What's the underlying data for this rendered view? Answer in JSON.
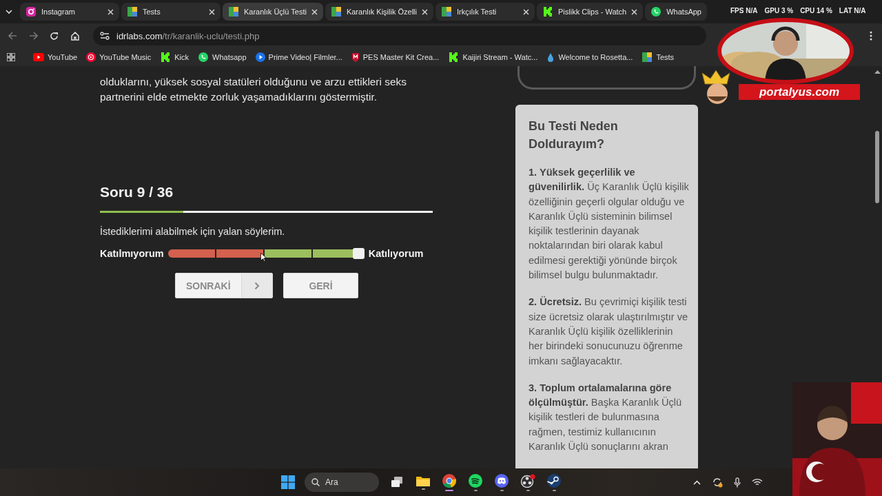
{
  "tabs": [
    {
      "label": "Instagram",
      "kind": "camera",
      "selected": false
    },
    {
      "label": "Tests",
      "kind": "grid",
      "selected": false
    },
    {
      "label": "Karanlık Üçlü Testi",
      "kind": "grid",
      "selected": true
    },
    {
      "label": "Karanlık Kişilik Özelli",
      "kind": "grid",
      "selected": false
    },
    {
      "label": "Irkçılık Testi",
      "kind": "grid",
      "selected": false
    },
    {
      "label": "Pislikk Clips - Watch",
      "kind": "letter",
      "selected": false
    },
    {
      "label": "WhatsApp",
      "kind": "chat",
      "selected": false
    }
  ],
  "toolbar": {
    "url_host": "idrlabs.com",
    "url_path": "/tr/karanlik-uclu/testi.php"
  },
  "bookmarks": [
    {
      "label": "YouTube",
      "kind": "play"
    },
    {
      "label": "YouTube Music",
      "kind": "disc"
    },
    {
      "label": "Kick",
      "kind": "letter"
    },
    {
      "label": "Whatsapp",
      "kind": "chat"
    },
    {
      "label": "Prime Video| Filmler...",
      "kind": "circle"
    },
    {
      "label": "PES Master Kit Crea...",
      "kind": "shield"
    },
    {
      "label": "Kaijiri Stream - Watc...",
      "kind": "letter"
    },
    {
      "label": "Welcome to Rosetta...",
      "kind": "drop"
    },
    {
      "label": "Tests",
      "kind": "grid"
    }
  ],
  "overlay_stats": [
    {
      "label": "FPS",
      "value": "N/A"
    },
    {
      "label": "GPU",
      "value": "3 %"
    },
    {
      "label": "CPU",
      "value": "14 %"
    },
    {
      "label": "LAT",
      "value": "N/A"
    }
  ],
  "stream_banner": "portalyus.com",
  "quiz": {
    "intro": "olduklarını, yüksek sosyal statüleri olduğunu ve arzu ettikleri seks partnerini elde etmekte zorluk yaşamadıklarını göstermiştir.",
    "title": "Soru 9 / 36",
    "progress": {
      "level": 0.25
    },
    "question": "İstediklerimi alabilmek için yalan söylerim.",
    "scale": {
      "left": "Katılmıyorum",
      "right": "Katılıyorum",
      "level": 1
    },
    "buttons": [
      {
        "label": "SONRAKİ",
        "kind": "next"
      },
      {
        "label": "GERİ",
        "kind": "back"
      }
    ]
  },
  "sidebar": {
    "title": "Bu Testi Neden Doldurayım?",
    "paragraphs": [
      "**1. Yüksek geçerlilik ve güvenilirlik.** Üç Karanlık Üçlü kişilik özelliğinin geçerli olgular olduğu ve Karanlık Üçlü sisteminin bilimsel kişilik testlerinin dayanak noktalarından biri olarak kabul edilmesi gerektiği yönünde birçok bilimsel bulgu bulunmaktadır.",
      "**2. Ücretsiz.** Bu çevrimiçi kişilik testi size ücretsiz olarak ulaştırılmıştır ve Karanlık Üçlü kişilik özelliklerinin her birindeki sonucunuzu öğrenme imkanı sağlayacaktır.",
      "**3. Toplum ortalamalarına göre ölçülmüştür.** Başka Karanlık Üçlü kişilik testleri de bulunmasına rağmen, testimiz kullanıcının Karanlık Üçlü sonuçlarını akran"
    ]
  },
  "taskbar": {
    "search_placeholder": "Ara"
  }
}
